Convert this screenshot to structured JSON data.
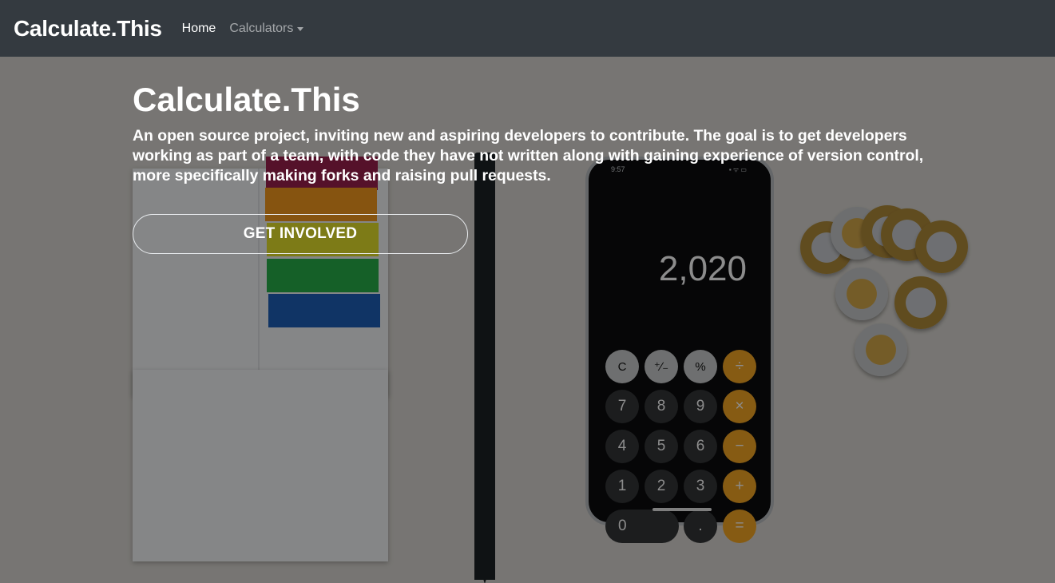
{
  "navbar": {
    "brand": "Calculate.This",
    "items": [
      {
        "label": "Home"
      },
      {
        "label": "Calculators"
      }
    ]
  },
  "hero": {
    "title": "Calculate.This",
    "description": "An open source project, inviting new and aspiring developers to contribute. The goal is to get developers working as part of a team, with code they have not written along with gaining experience of version control, more specifically making forks and raising pull requests.",
    "cta_label": "GET INVOLVED"
  },
  "background_photo": {
    "phone_time": "9:57",
    "calculator_display": "2,020",
    "calculator_keys": [
      "C",
      "⁺∕₋",
      "%",
      "÷",
      "7",
      "8",
      "9",
      "×",
      "4",
      "5",
      "6",
      "−",
      "1",
      "2",
      "3",
      "+",
      "0",
      ".",
      "="
    ]
  },
  "colors": {
    "navbar_bg": "#343a40",
    "text": "#ffffff",
    "nav_inactive": "rgba(255,255,255,0.55)",
    "calculator_operator": "#f5a623"
  }
}
